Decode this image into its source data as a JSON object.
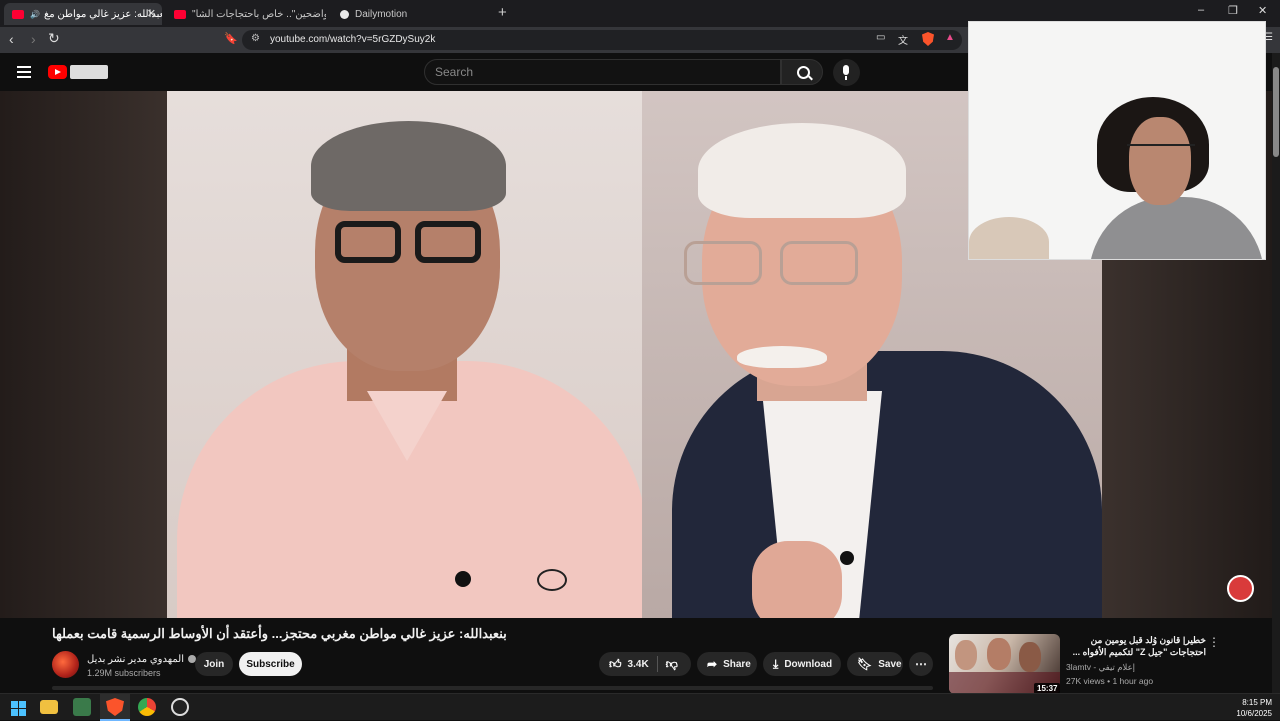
{
  "browser": {
    "tabs": [
      {
        "label": "بنعبدالله: عزيز غالي مواطن مغ",
        "active": true
      },
      {
        "label": "\"تكونو واضحين\".. خاص باحتجاجات الشا",
        "active": false
      },
      {
        "label": "Dailymotion",
        "active": false
      }
    ],
    "new_tab": "+",
    "url": "youtube.com/watch?v=5rGZDySuy2k",
    "controls": {
      "minimize": "–",
      "restore": "❐",
      "close": "✕"
    }
  },
  "masthead": {
    "search_placeholder": "Search"
  },
  "video": {
    "title": "بنعبدالله: عزيز غالي مواطن مغربي محتجز... وأعتقد أن الأوساط الرسمية قامت بعملها",
    "channel_name": "المهدوي مدير نشر بديل",
    "subscribers": "1.29M subscribers",
    "join_label": "Join",
    "subscribe_label": "Subscribe",
    "likes": "3.4K",
    "share_label": "Share",
    "download_label": "Download",
    "save_label": "Save",
    "more_label": "⋯"
  },
  "recommendation": {
    "title": "خطير| قانون وُلد قبل يومين من احتجاجات \"جيل Z\" لتكميم الأفواه ... هذه المطالب التي ...",
    "duration": "15:37",
    "channel": "3lamtv - إعلام تيفي",
    "meta": "27K views • 1 hour ago"
  },
  "taskbar": {
    "time": "8:15 PM",
    "date": "10/6/2025"
  },
  "colors": {
    "youtube_red": "#ff0000",
    "background": "#0f0f0f",
    "pill": "#272727"
  }
}
